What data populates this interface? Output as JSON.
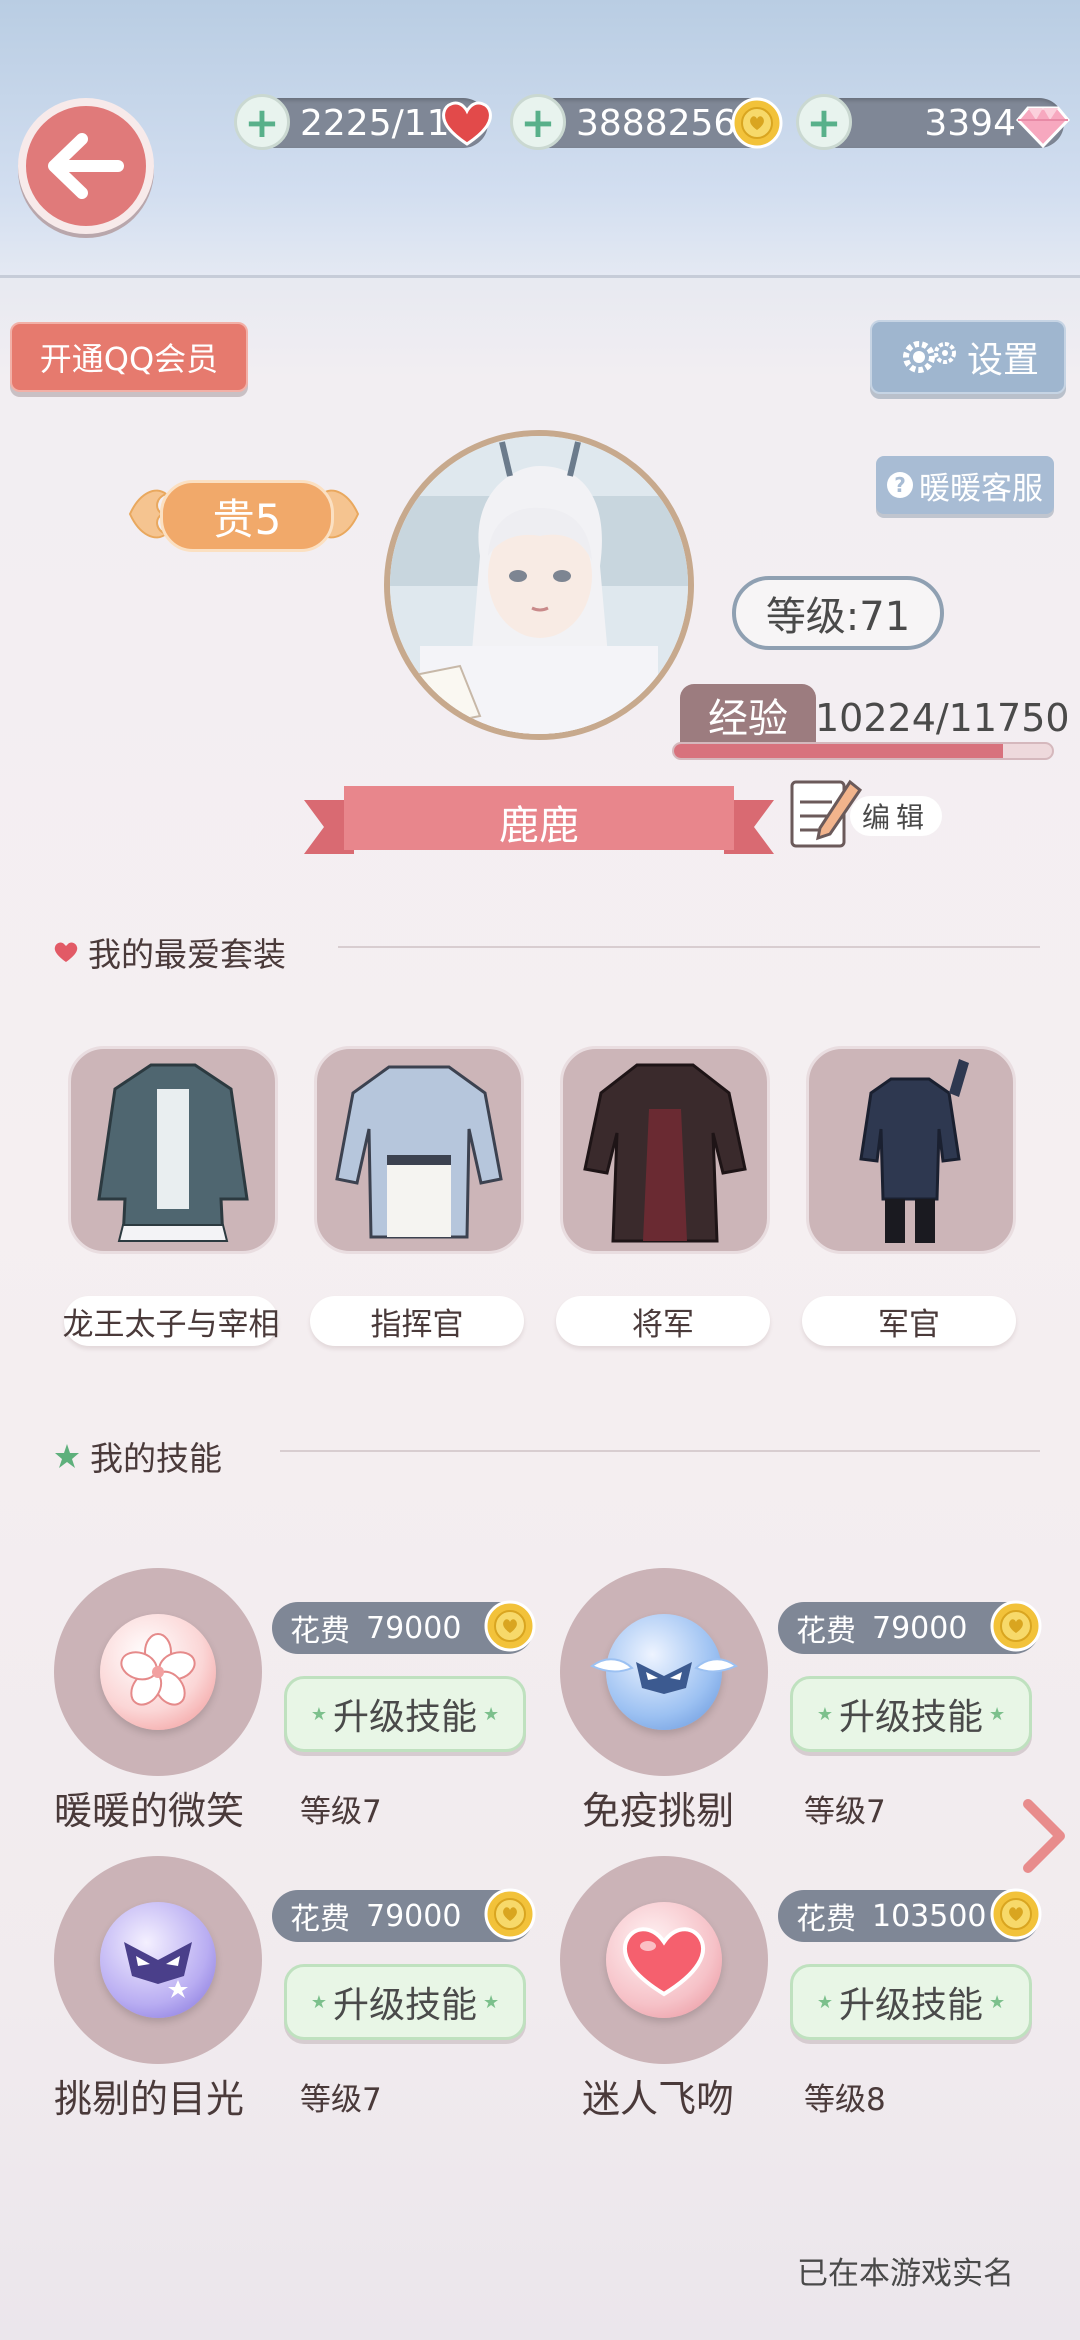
{
  "resources": {
    "stamina": "2225/110",
    "gold": "3888256",
    "diamond": "3394"
  },
  "buttons": {
    "qq_vip": "开通QQ会员",
    "settings": "设置",
    "customer_service": "暖暖客服"
  },
  "profile": {
    "vip_level": "贵5",
    "level": "等级:71",
    "exp_label": "经验",
    "exp_value": "10224/11750",
    "exp_progress": 0.87,
    "name": "鹿鹿",
    "edit_label": "编辑"
  },
  "favorites": {
    "title": "我的最爱套装",
    "items": [
      {
        "label": "龙王太子与宰相"
      },
      {
        "label": "指挥官"
      },
      {
        "label": "将军"
      },
      {
        "label": "军官"
      }
    ]
  },
  "skills": {
    "title": "我的技能",
    "cost_label": "花费",
    "items": [
      {
        "name": "暖暖的微笑",
        "level": "等级7",
        "cost": "79000",
        "upgrade": "升级技能"
      },
      {
        "name": "免疫挑剔",
        "level": "等级7",
        "cost": "79000",
        "upgrade": "升级技能"
      },
      {
        "name": "挑剔的目光",
        "level": "等级7",
        "cost": "79000",
        "upgrade": "升级技能"
      },
      {
        "name": "迷人飞吻",
        "level": "等级8",
        "cost": "103500",
        "upgrade": "升级技能"
      }
    ]
  },
  "footer": {
    "realname": "已在本游戏实名"
  },
  "colors": {
    "accent_red": "#e07a7a",
    "pill_gray": "#7f8796",
    "upgrade_green": "#e8f6e6"
  }
}
